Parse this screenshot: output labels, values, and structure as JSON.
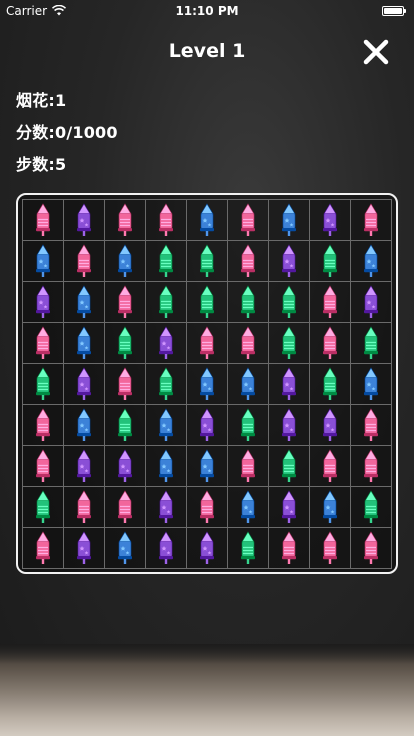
{
  "status_bar": {
    "carrier": "Carrier",
    "time": "11:10 PM"
  },
  "header": {
    "title": "Level 1",
    "close_icon": "close-icon"
  },
  "stats": {
    "fireworks": "烟花:1",
    "score": "分数:0/1000",
    "steps": "步数:5"
  },
  "piece_colors": {
    "pink": "#f2669c",
    "blue": "#3c82d8",
    "purple": "#8a4fd6",
    "green": "#22c27a"
  },
  "board": {
    "rows": 9,
    "cols": 9,
    "cells": [
      [
        "pink",
        "purple",
        "pink",
        "pink",
        "blue",
        "pink",
        "blue",
        "purple",
        "pink"
      ],
      [
        "blue",
        "pink",
        "blue",
        "green",
        "green",
        "pink",
        "purple",
        "green",
        "blue"
      ],
      [
        "purple",
        "blue",
        "pink",
        "green",
        "green",
        "green",
        "green",
        "pink",
        "purple"
      ],
      [
        "pink",
        "blue",
        "green",
        "purple",
        "pink",
        "pink",
        "green",
        "pink",
        "green"
      ],
      [
        "green",
        "purple",
        "pink",
        "green",
        "blue",
        "blue",
        "purple",
        "green",
        "blue"
      ],
      [
        "pink",
        "blue",
        "green",
        "blue",
        "purple",
        "green",
        "purple",
        "purple",
        "pink"
      ],
      [
        "pink",
        "purple",
        "purple",
        "blue",
        "blue",
        "pink",
        "green",
        "pink",
        "pink"
      ],
      [
        "green",
        "pink",
        "pink",
        "purple",
        "pink",
        "blue",
        "purple",
        "blue",
        "green"
      ],
      [
        "pink",
        "purple",
        "blue",
        "purple",
        "purple",
        "green",
        "pink",
        "pink",
        "pink"
      ]
    ]
  }
}
